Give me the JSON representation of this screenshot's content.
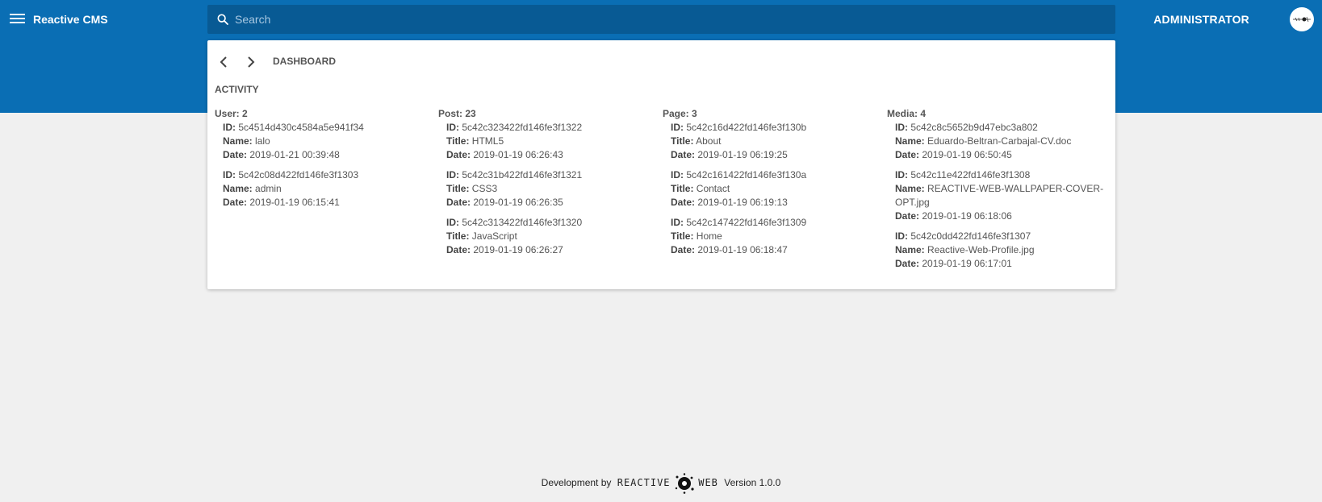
{
  "app": {
    "title": "Reactive CMS",
    "user": "ADMINISTRATOR"
  },
  "search": {
    "placeholder": "Search",
    "value": ""
  },
  "breadcrumb": {
    "label": "DASHBOARD"
  },
  "activity": {
    "title": "ACTIVITY",
    "columns": [
      {
        "heading": "User: 2",
        "entries": [
          {
            "id_label": "ID:",
            "id": "5c4514d430c4584a5e941f34",
            "field_label": "Name:",
            "field": "lalo",
            "date_label": "Date:",
            "date": "2019-01-21 00:39:48"
          },
          {
            "id_label": "ID:",
            "id": "5c42c08d422fd146fe3f1303",
            "field_label": "Name:",
            "field": "admin",
            "date_label": "Date:",
            "date": "2019-01-19 06:15:41"
          }
        ]
      },
      {
        "heading": "Post: 23",
        "entries": [
          {
            "id_label": "ID:",
            "id": "5c42c323422fd146fe3f1322",
            "field_label": "Title:",
            "field": "HTML5",
            "date_label": "Date:",
            "date": "2019-01-19 06:26:43"
          },
          {
            "id_label": "ID:",
            "id": "5c42c31b422fd146fe3f1321",
            "field_label": "Title:",
            "field": "CSS3",
            "date_label": "Date:",
            "date": "2019-01-19 06:26:35"
          },
          {
            "id_label": "ID:",
            "id": "5c42c313422fd146fe3f1320",
            "field_label": "Title:",
            "field": "JavaScript",
            "date_label": "Date:",
            "date": "2019-01-19 06:26:27"
          }
        ]
      },
      {
        "heading": "Page: 3",
        "entries": [
          {
            "id_label": "ID:",
            "id": "5c42c16d422fd146fe3f130b",
            "field_label": "Title:",
            "field": "About",
            "date_label": "Date:",
            "date": "2019-01-19 06:19:25"
          },
          {
            "id_label": "ID:",
            "id": "5c42c161422fd146fe3f130a",
            "field_label": "Title:",
            "field": "Contact",
            "date_label": "Date:",
            "date": "2019-01-19 06:19:13"
          },
          {
            "id_label": "ID:",
            "id": "5c42c147422fd146fe3f1309",
            "field_label": "Title:",
            "field": "Home",
            "date_label": "Date:",
            "date": "2019-01-19 06:18:47"
          }
        ]
      },
      {
        "heading": "Media: 4",
        "entries": [
          {
            "id_label": "ID:",
            "id": "5c42c8c5652b9d47ebc3a802",
            "field_label": "Name:",
            "field": "Eduardo-Beltran-Carbajal-CV.doc",
            "date_label": "Date:",
            "date": "2019-01-19 06:50:45"
          },
          {
            "id_label": "ID:",
            "id": "5c42c11e422fd146fe3f1308",
            "field_label": "Name:",
            "field": "REACTIVE-WEB-WALLPAPER-COVER-OPT.jpg",
            "date_label": "Date:",
            "date": "2019-01-19 06:18:06"
          },
          {
            "id_label": "ID:",
            "id": "5c42c0dd422fd146fe3f1307",
            "field_label": "Name:",
            "field": "Reactive-Web-Profile.jpg",
            "date_label": "Date:",
            "date": "2019-01-19 06:17:01"
          }
        ]
      }
    ]
  },
  "footer": {
    "prefix": "Development by",
    "brand_left": "REACTIVE",
    "brand_right": "WEB",
    "version": "Version 1.0.0"
  },
  "icons": {
    "menu": "menu-icon",
    "search": "search-icon",
    "back": "chevron-left-icon",
    "forward": "chevron-right-icon",
    "avatar": "user-avatar"
  },
  "colors": {
    "primary": "#0a6eb4",
    "search_bg": "#085a94",
    "page_bg": "#f0f0f0"
  }
}
